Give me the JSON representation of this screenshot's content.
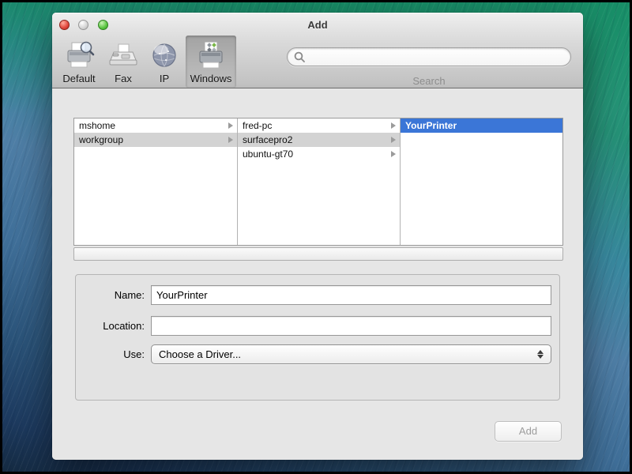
{
  "window": {
    "title": "Add"
  },
  "titlebar": {
    "traffic_lights": [
      "close",
      "minimize",
      "zoom"
    ]
  },
  "toolbar": {
    "items": [
      {
        "label": "Default",
        "icon": "printer-search-icon",
        "selected": false
      },
      {
        "label": "Fax",
        "icon": "fax-icon",
        "selected": false
      },
      {
        "label": "IP",
        "icon": "globe-icon",
        "selected": false
      },
      {
        "label": "Windows",
        "icon": "printer-windows-icon",
        "selected": true
      }
    ],
    "search": {
      "value": "",
      "label": "Search",
      "icon": "search-icon"
    }
  },
  "browser": {
    "columns": [
      {
        "items": [
          {
            "label": "mshome",
            "selected": false,
            "expandable": true
          },
          {
            "label": "workgroup",
            "selected": true,
            "expandable": true
          }
        ]
      },
      {
        "items": [
          {
            "label": "fred-pc",
            "selected": false,
            "expandable": true
          },
          {
            "label": "surfacepro2",
            "selected": true,
            "expandable": true
          },
          {
            "label": "ubuntu-gt70",
            "selected": false,
            "expandable": true
          }
        ]
      },
      {
        "items": [
          {
            "label": "YourPrinter",
            "selected": true,
            "expandable": false
          }
        ]
      }
    ]
  },
  "form": {
    "name_label": "Name:",
    "name_value": "YourPrinter",
    "location_label": "Location:",
    "location_value": "",
    "use_label": "Use:",
    "use_value": "Choose a Driver..."
  },
  "footer": {
    "add_label": "Add",
    "add_enabled": false
  },
  "colors": {
    "selection_blue": "#3b76d7",
    "row_highlight_gray": "#d3d3d3",
    "toolbar_selected_bg": "#a9a9a9",
    "wallpaper_green": "#27a07b",
    "wallpaper_blue": "#1d3a5f"
  }
}
